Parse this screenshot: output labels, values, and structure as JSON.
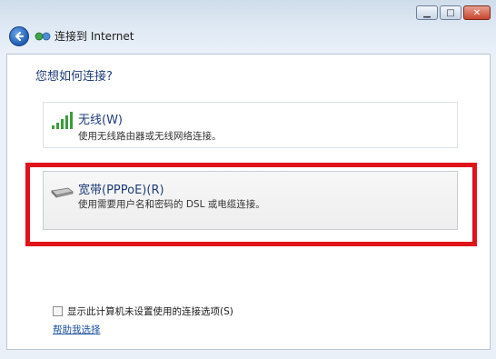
{
  "window": {
    "title": "连接到 Internet",
    "controls": {
      "minimize": "▁",
      "maximize": "□",
      "close": "✕"
    }
  },
  "main": {
    "heading": "您想如何连接?",
    "options": [
      {
        "title": "无线(W)",
        "description": "使用无线路由器或无线网络连接。",
        "icon": "wireless-signal-icon"
      },
      {
        "title": "宽带(PPPoE)(R)",
        "description": "使用需要用户名和密码的 DSL 或电缆连接。",
        "icon": "broadband-modem-icon"
      }
    ],
    "show_options_label": "显示此计算机未设置使用的连接选项(S)",
    "help_link": "帮助我选择"
  },
  "colors": {
    "highlight": "#e0121a",
    "heading": "#1f3c7a",
    "link": "#1a4f9c"
  }
}
